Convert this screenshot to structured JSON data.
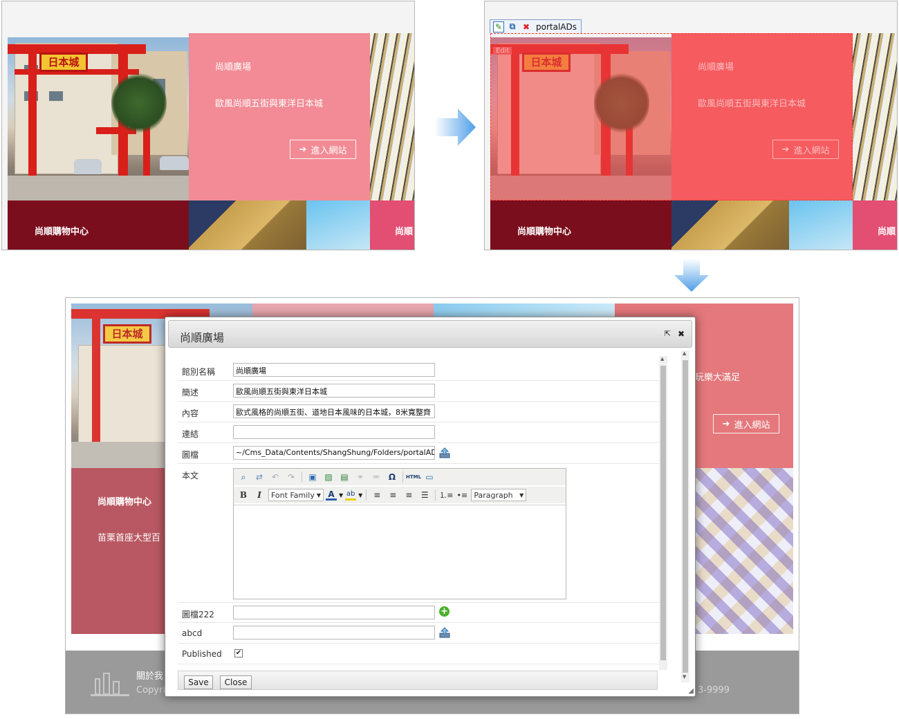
{
  "colors": {
    "pink_panel": "#f28b95",
    "pink_edit": "#f55b5f",
    "maroon": "#7a0e1d",
    "rose": "#e34e73",
    "arrow": "#5aa5ea"
  },
  "preview": {
    "slide_title": "尚順廣場",
    "slide_desc": "歐風尚順五街與東洋日本城",
    "enter_btn": "進入網站",
    "mall_title": "尚順購物中心",
    "next_partial": "尚順",
    "torii_sign": "日本城"
  },
  "edit_view": {
    "toolbar_label": "portalADs",
    "edit_badge": "Edit"
  },
  "background_page": {
    "mall_title": "尚順購物中心",
    "mall_desc": "苗栗首座大型百",
    "right_desc": "玩樂大滿足",
    "enter_btn": "進入網站",
    "footer_about": "關於我",
    "footer_copy": "Copyri",
    "footer_phone": "3-9999"
  },
  "modal": {
    "title": "尚順廣場",
    "fields": {
      "name_label": "館別名稱",
      "name_value": "尚順廣場",
      "summary_label": "簡述",
      "summary_value": "歐風尚順五街與東洋日本城",
      "content_label": "內容",
      "content_value": "歐式風格的尚順五街、道地日本風味的日本城，8米寬整齊",
      "link_label": "連結",
      "link_value": "",
      "image_label": "圖檔",
      "image_value": "~/Cms_Data/Contents/ShangShung/Folders/portalADs/",
      "body_label": "本文",
      "image2_label": "圖檔222",
      "image2_value": "",
      "abcd_label": "abcd",
      "abcd_value": "",
      "published_label": "Published"
    },
    "editor": {
      "font_family": "Font Family",
      "format": "Paragraph",
      "html_btn": "HTML"
    },
    "buttons": {
      "save": "Save",
      "close": "Close"
    }
  }
}
